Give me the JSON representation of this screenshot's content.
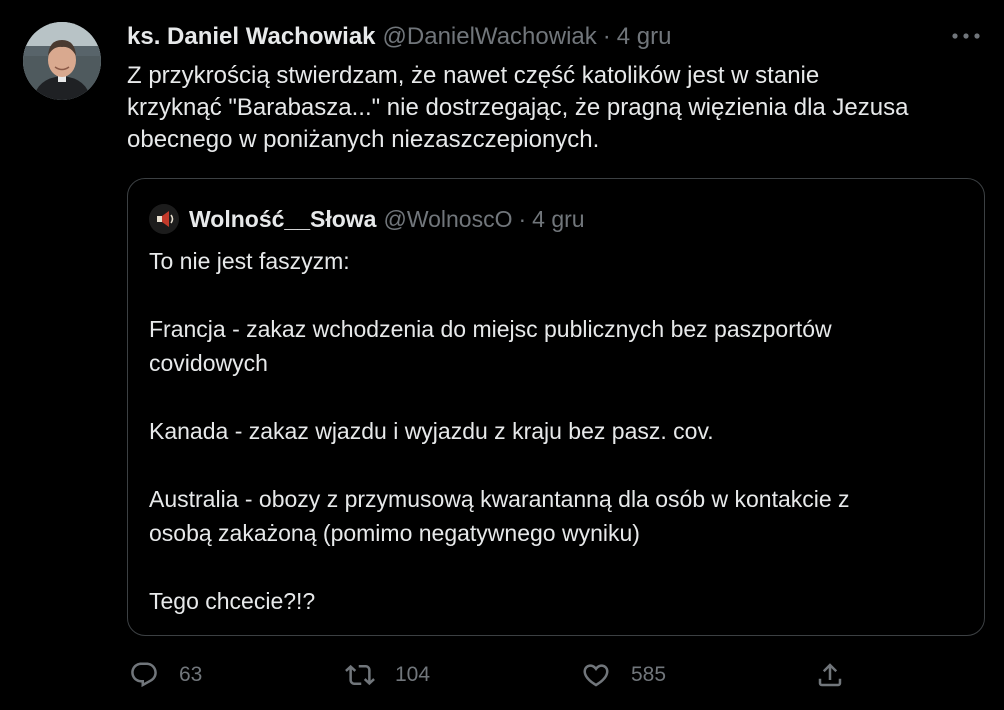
{
  "tweet": {
    "author_name": "ks. Daniel Wachowiak",
    "handle": "@DanielWachowiak",
    "separator": "·",
    "date": "4 gru",
    "text": "Z przykrością stwierdzam, że nawet część katolików jest w stanie\nkrzyknąć \"Barabasza...\" nie dostrzegając, że pragną więzienia dla Jezusa\nobecnego w poniżanych niezaszczepionych.",
    "more_icon": "more-horizontal-icon"
  },
  "quoted_tweet": {
    "author_name": "Wolność__Słowa",
    "handle": "@WolnoscO",
    "separator": "·",
    "date": "4 gru",
    "text": "To nie jest faszyzm:\n\nFrancja - zakaz wchodzenia do miejsc publicznych bez paszportów\ncovidowych\n\nKanada - zakaz wjazdu i wyjazdu z kraju bez pasz. cov.\n\nAustralia - obozy z przymusową kwarantanną dla osób w kontakcie z\nosobą zakażoną (pomimo negatywnego wyniku)\n\nTego chcecie?!?"
  },
  "actions": {
    "reply_count": "63",
    "retweet_count": "104",
    "like_count": "585",
    "reply_icon": "reply-icon",
    "retweet_icon": "retweet-icon",
    "like_icon": "heart-icon",
    "share_icon": "share-icon"
  },
  "colors": {
    "background": "#000000",
    "text_primary": "#e7e9ea",
    "text_secondary": "#71767b",
    "border": "#3c4043"
  }
}
